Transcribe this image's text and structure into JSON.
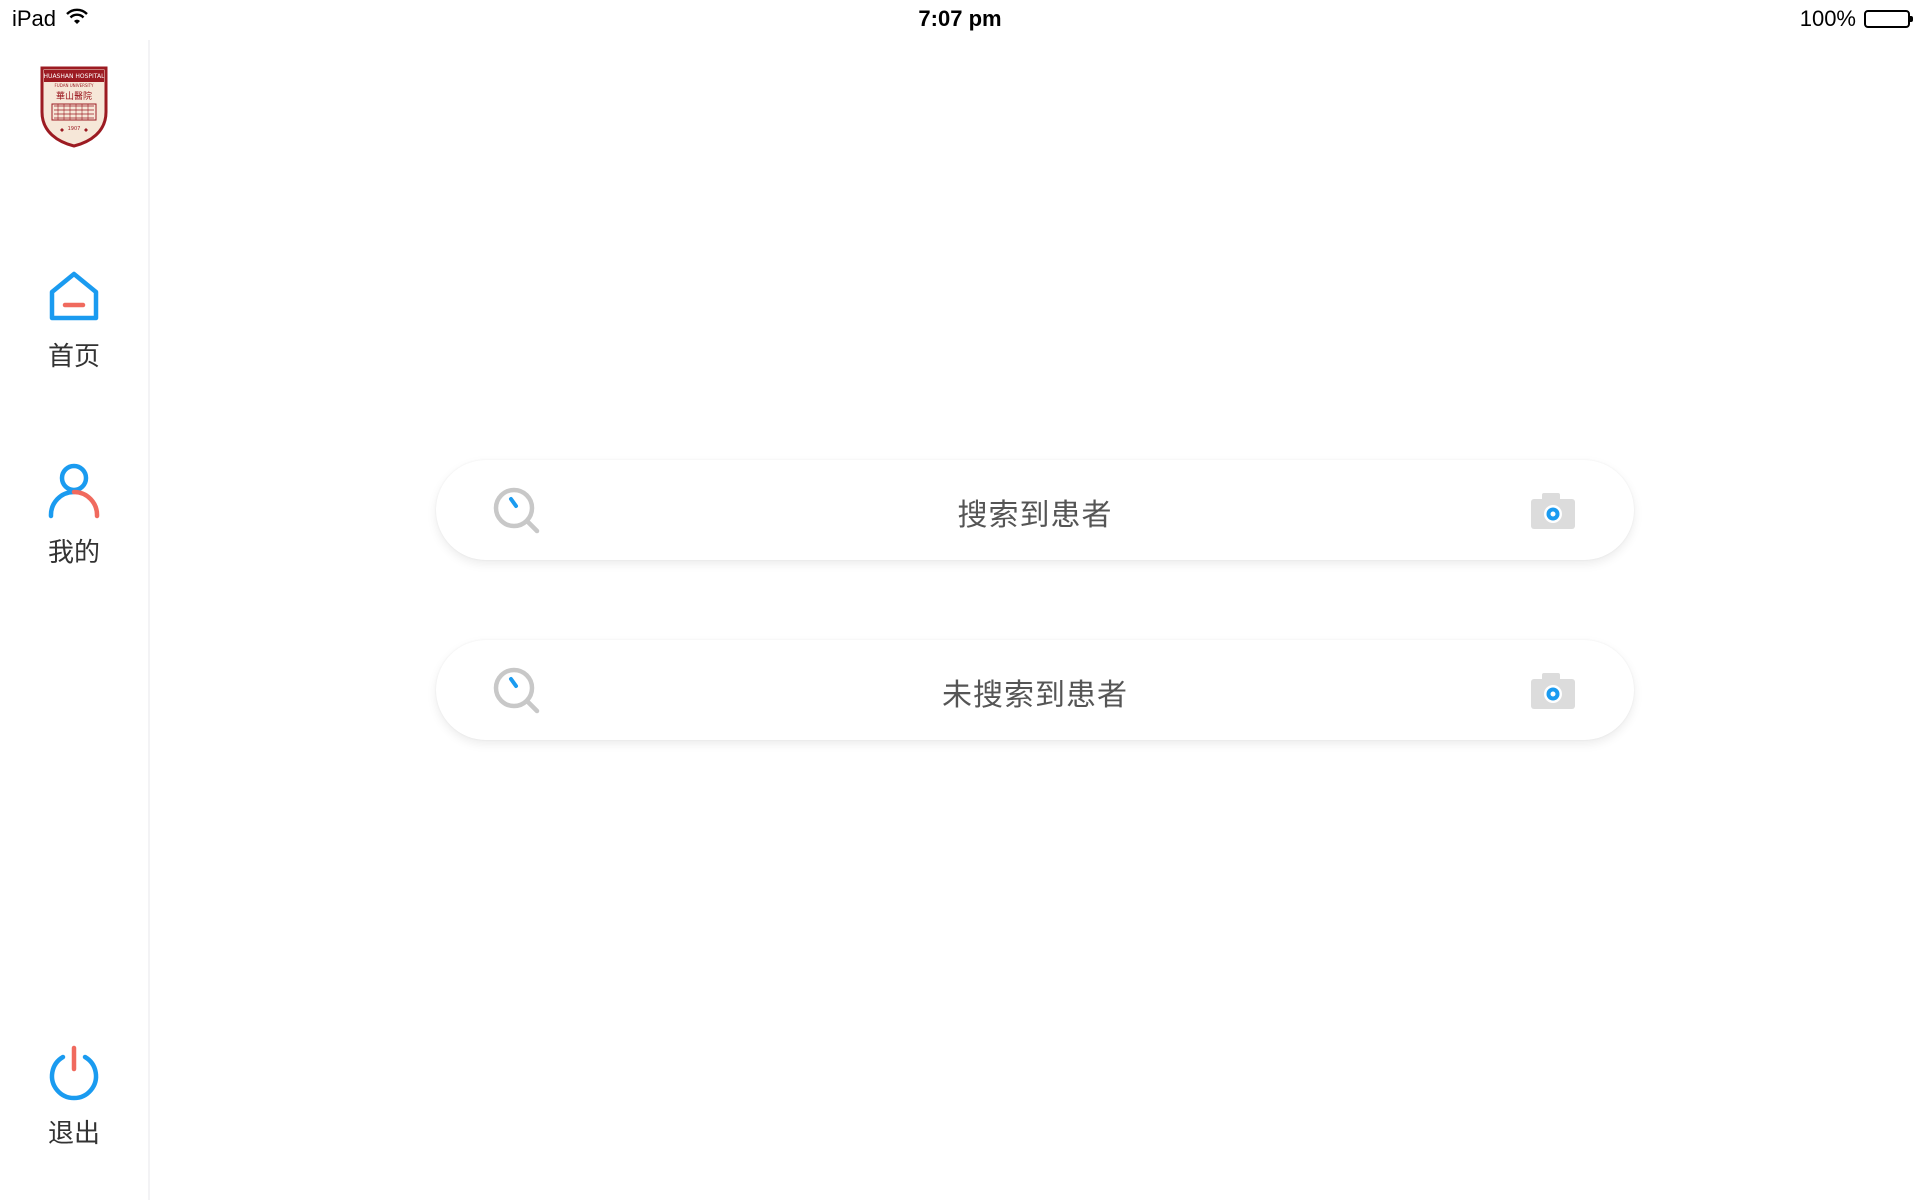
{
  "status_bar": {
    "device": "iPad",
    "time": "7:07 pm",
    "battery_percent": "100%",
    "battery_level": 1.0,
    "icons": [
      "wifi-icon",
      "battery-icon"
    ]
  },
  "sidebar": {
    "logo": {
      "name": "huashan-hospital-logo",
      "text_top": "HUASHAN HOSPITAL",
      "text_sub": "FUDAN UNIVERSITY",
      "chinese": "華山醫院",
      "year": "1907"
    },
    "items": [
      {
        "label": "首页",
        "icon": "home-icon"
      },
      {
        "label": "我的",
        "icon": "user-icon"
      },
      {
        "label": "退出",
        "icon": "power-icon"
      }
    ]
  },
  "main": {
    "cards": [
      {
        "label": "搜索到患者",
        "left_icon": "search-icon",
        "right_icon": "camera-icon"
      },
      {
        "label": "未搜索到患者",
        "left_icon": "search-icon",
        "right_icon": "camera-icon"
      }
    ]
  },
  "colors": {
    "accent_blue": "#1a9bf0",
    "accent_red": "#f06a5e",
    "icon_gray": "#c8c8c8",
    "text": "#333333"
  }
}
